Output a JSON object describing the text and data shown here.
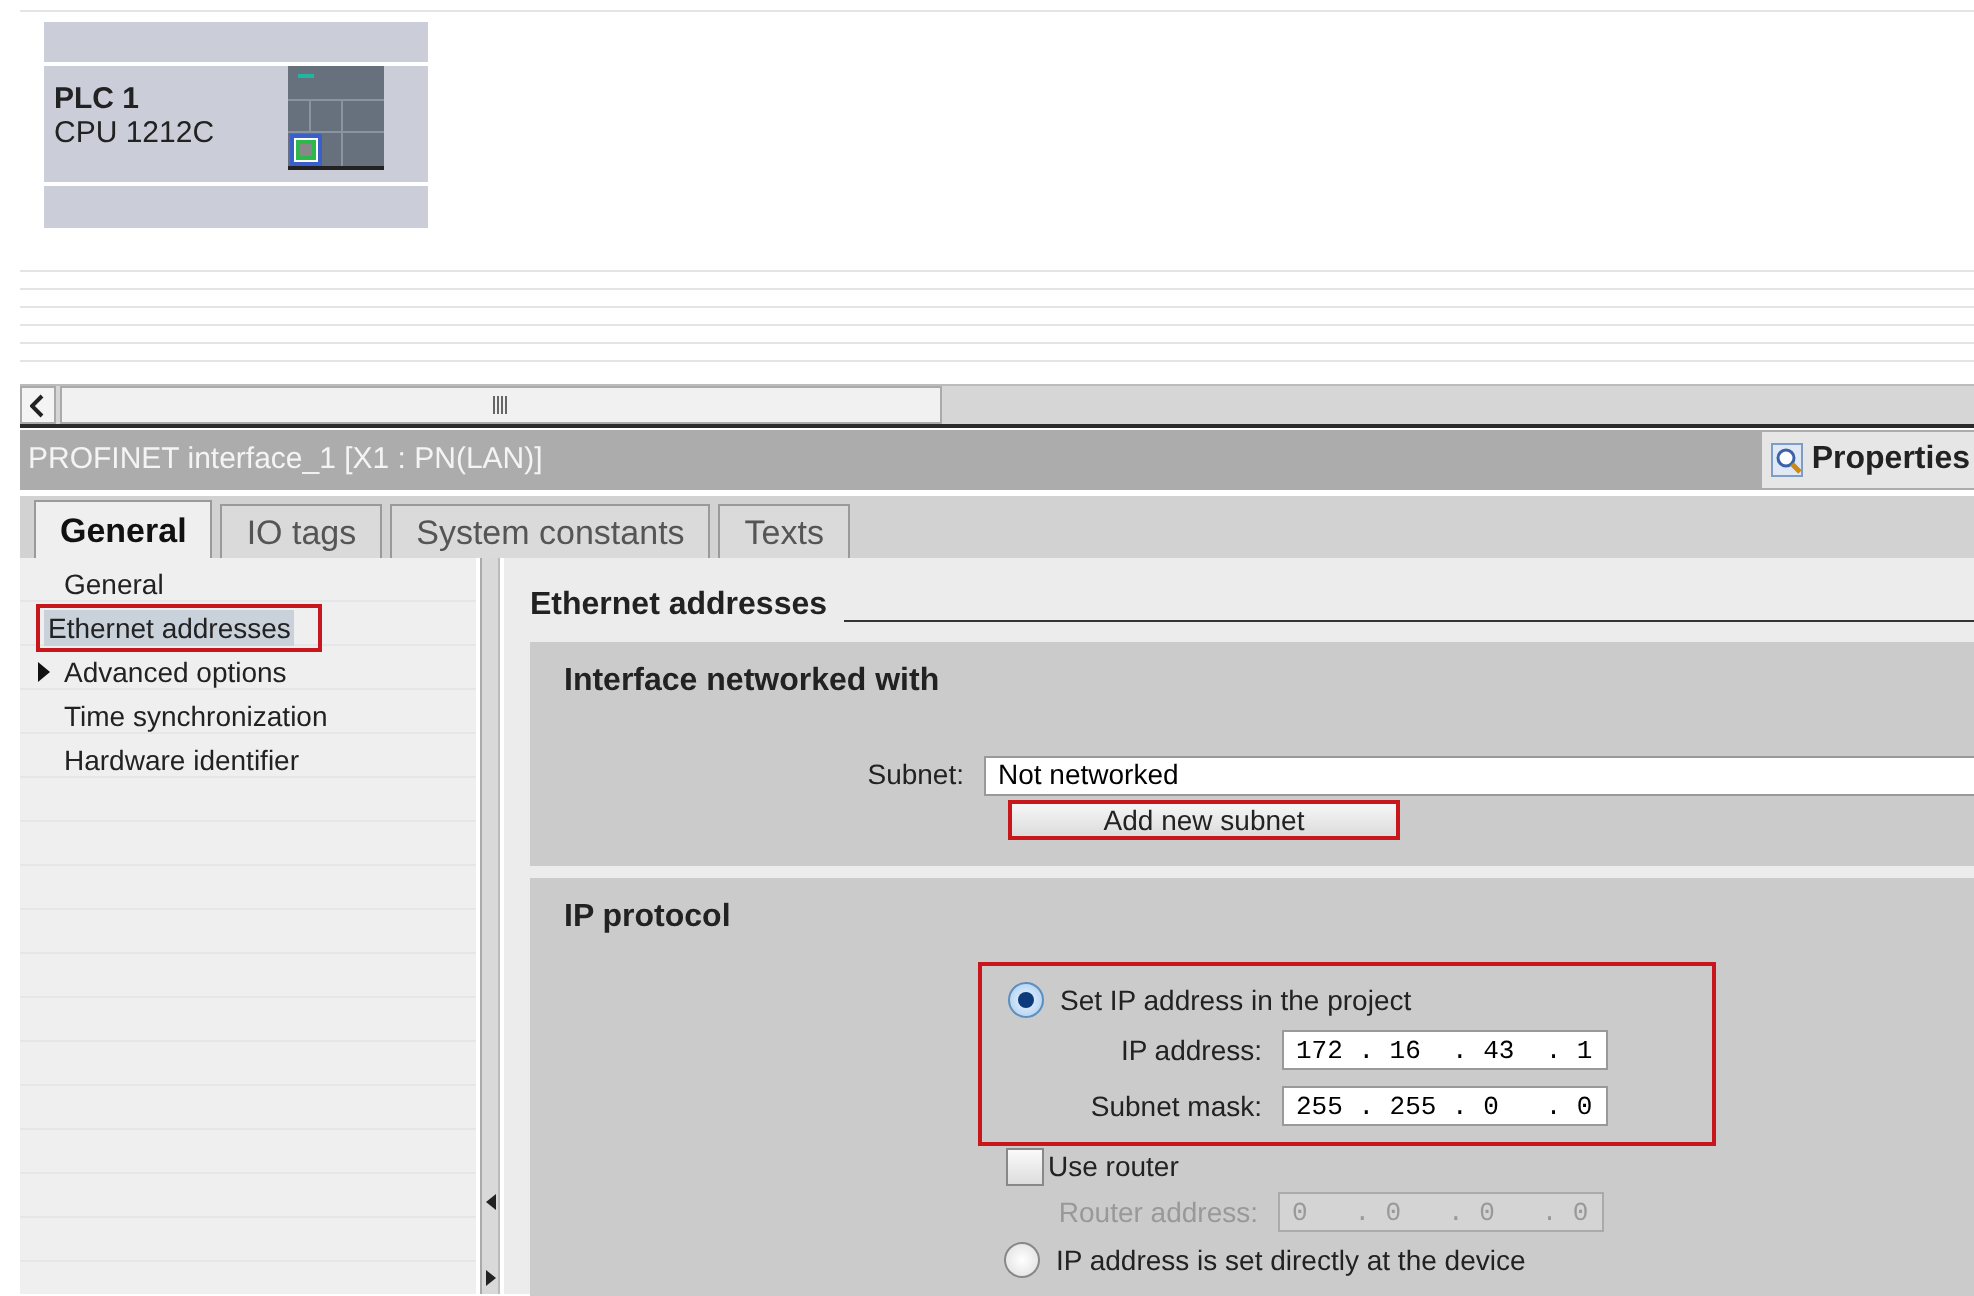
{
  "device": {
    "name": "PLC 1",
    "type": "CPU 1212C"
  },
  "inspector": {
    "title": "PROFINET interface_1 [X1 : PN(LAN)]",
    "view_tabs": [
      {
        "label": "Properties",
        "selected": true
      }
    ]
  },
  "tabs": [
    {
      "label": "General",
      "selected": true
    },
    {
      "label": "IO tags",
      "selected": false
    },
    {
      "label": "System constants",
      "selected": false
    },
    {
      "label": "Texts",
      "selected": false
    }
  ],
  "nav": [
    {
      "label": "General",
      "selected": false,
      "highlighted": false,
      "expandable": false
    },
    {
      "label": "Ethernet addresses",
      "selected": true,
      "highlighted": true,
      "expandable": false
    },
    {
      "label": "Advanced options",
      "selected": false,
      "highlighted": false,
      "expandable": true,
      "expanded": false
    },
    {
      "label": "Time synchronization",
      "selected": false,
      "highlighted": false,
      "expandable": false
    },
    {
      "label": "Hardware identifier",
      "selected": false,
      "highlighted": false,
      "expandable": false
    }
  ],
  "section_title": "Ethernet addresses",
  "interface_networked": {
    "title": "Interface networked with",
    "subnet_label": "Subnet:",
    "subnet_value": "Not networked",
    "add_button": {
      "label": "Add new subnet",
      "highlighted": true
    }
  },
  "ip_protocol": {
    "title": "IP protocol",
    "highlighted": true,
    "options": [
      {
        "label": "Set IP address in the project",
        "selected": true
      },
      {
        "label": "IP address is set directly at the device",
        "selected": false
      }
    ],
    "ip_address": {
      "label": "IP address:",
      "value": "172 . 16  . 43  . 1"
    },
    "subnet_mask": {
      "label": "Subnet mask:",
      "value": "255 . 255 . 0   . 0"
    },
    "use_router": {
      "label": "Use router",
      "checked": false
    },
    "router_address": {
      "label": "Router address:",
      "value": "0   . 0   . 0   . 0",
      "disabled": true
    }
  }
}
